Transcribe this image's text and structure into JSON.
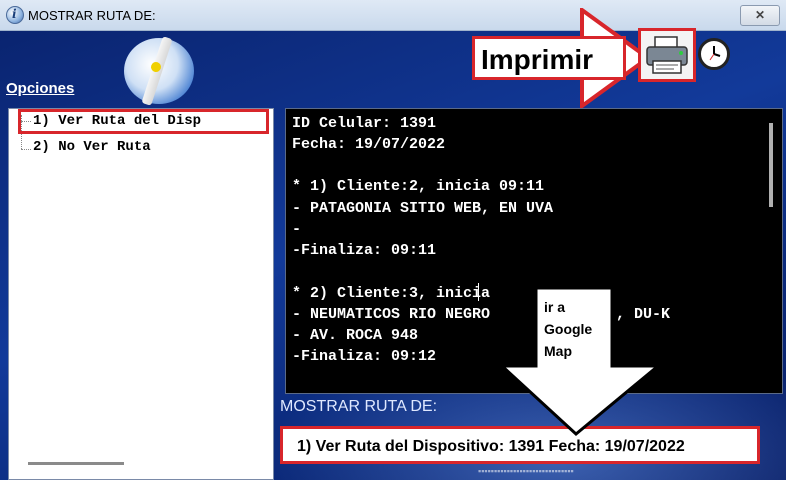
{
  "window": {
    "title": "MOSTRAR RUTA DE:",
    "close_label": "✕"
  },
  "sidebar": {
    "heading": "Opciones",
    "items": [
      {
        "label": "1) Ver Ruta  del Disp"
      },
      {
        "label": "2) No Ver Ruta"
      }
    ]
  },
  "console": {
    "lines": [
      "ID Celular: 1391",
      "Fecha: 19/07/2022",
      "",
      "* 1) Cliente:2, inicia 09:11",
      "- PATAGONIA SITIO WEB, EN UVA",
      "-",
      "-Finaliza: 09:11",
      "",
      "* 2) Cliente:3, inicia",
      "- NEUMATICOS RIO NEGRO",
      "- AV. ROCA 948",
      "-Finaliza: 09:12"
    ],
    "line_tail_du": ", DU-K"
  },
  "route_panel": {
    "label": "MOSTRAR RUTA DE:",
    "value": "1) Ver Ruta  del Dispositivo: 1391 Fecha: 19/07/2022"
  },
  "annotations": {
    "print_label": "Imprimir",
    "map_label_lines": [
      "ir a",
      "Google",
      "Map"
    ]
  },
  "icons": {
    "app": "app-icon",
    "logo": "compass-logo",
    "printer": "printer-icon",
    "clock": "clock-icon"
  },
  "colors": {
    "highlight_red": "#d8262b",
    "window_blue": "#0d2a78",
    "console_bg": "#000000"
  }
}
